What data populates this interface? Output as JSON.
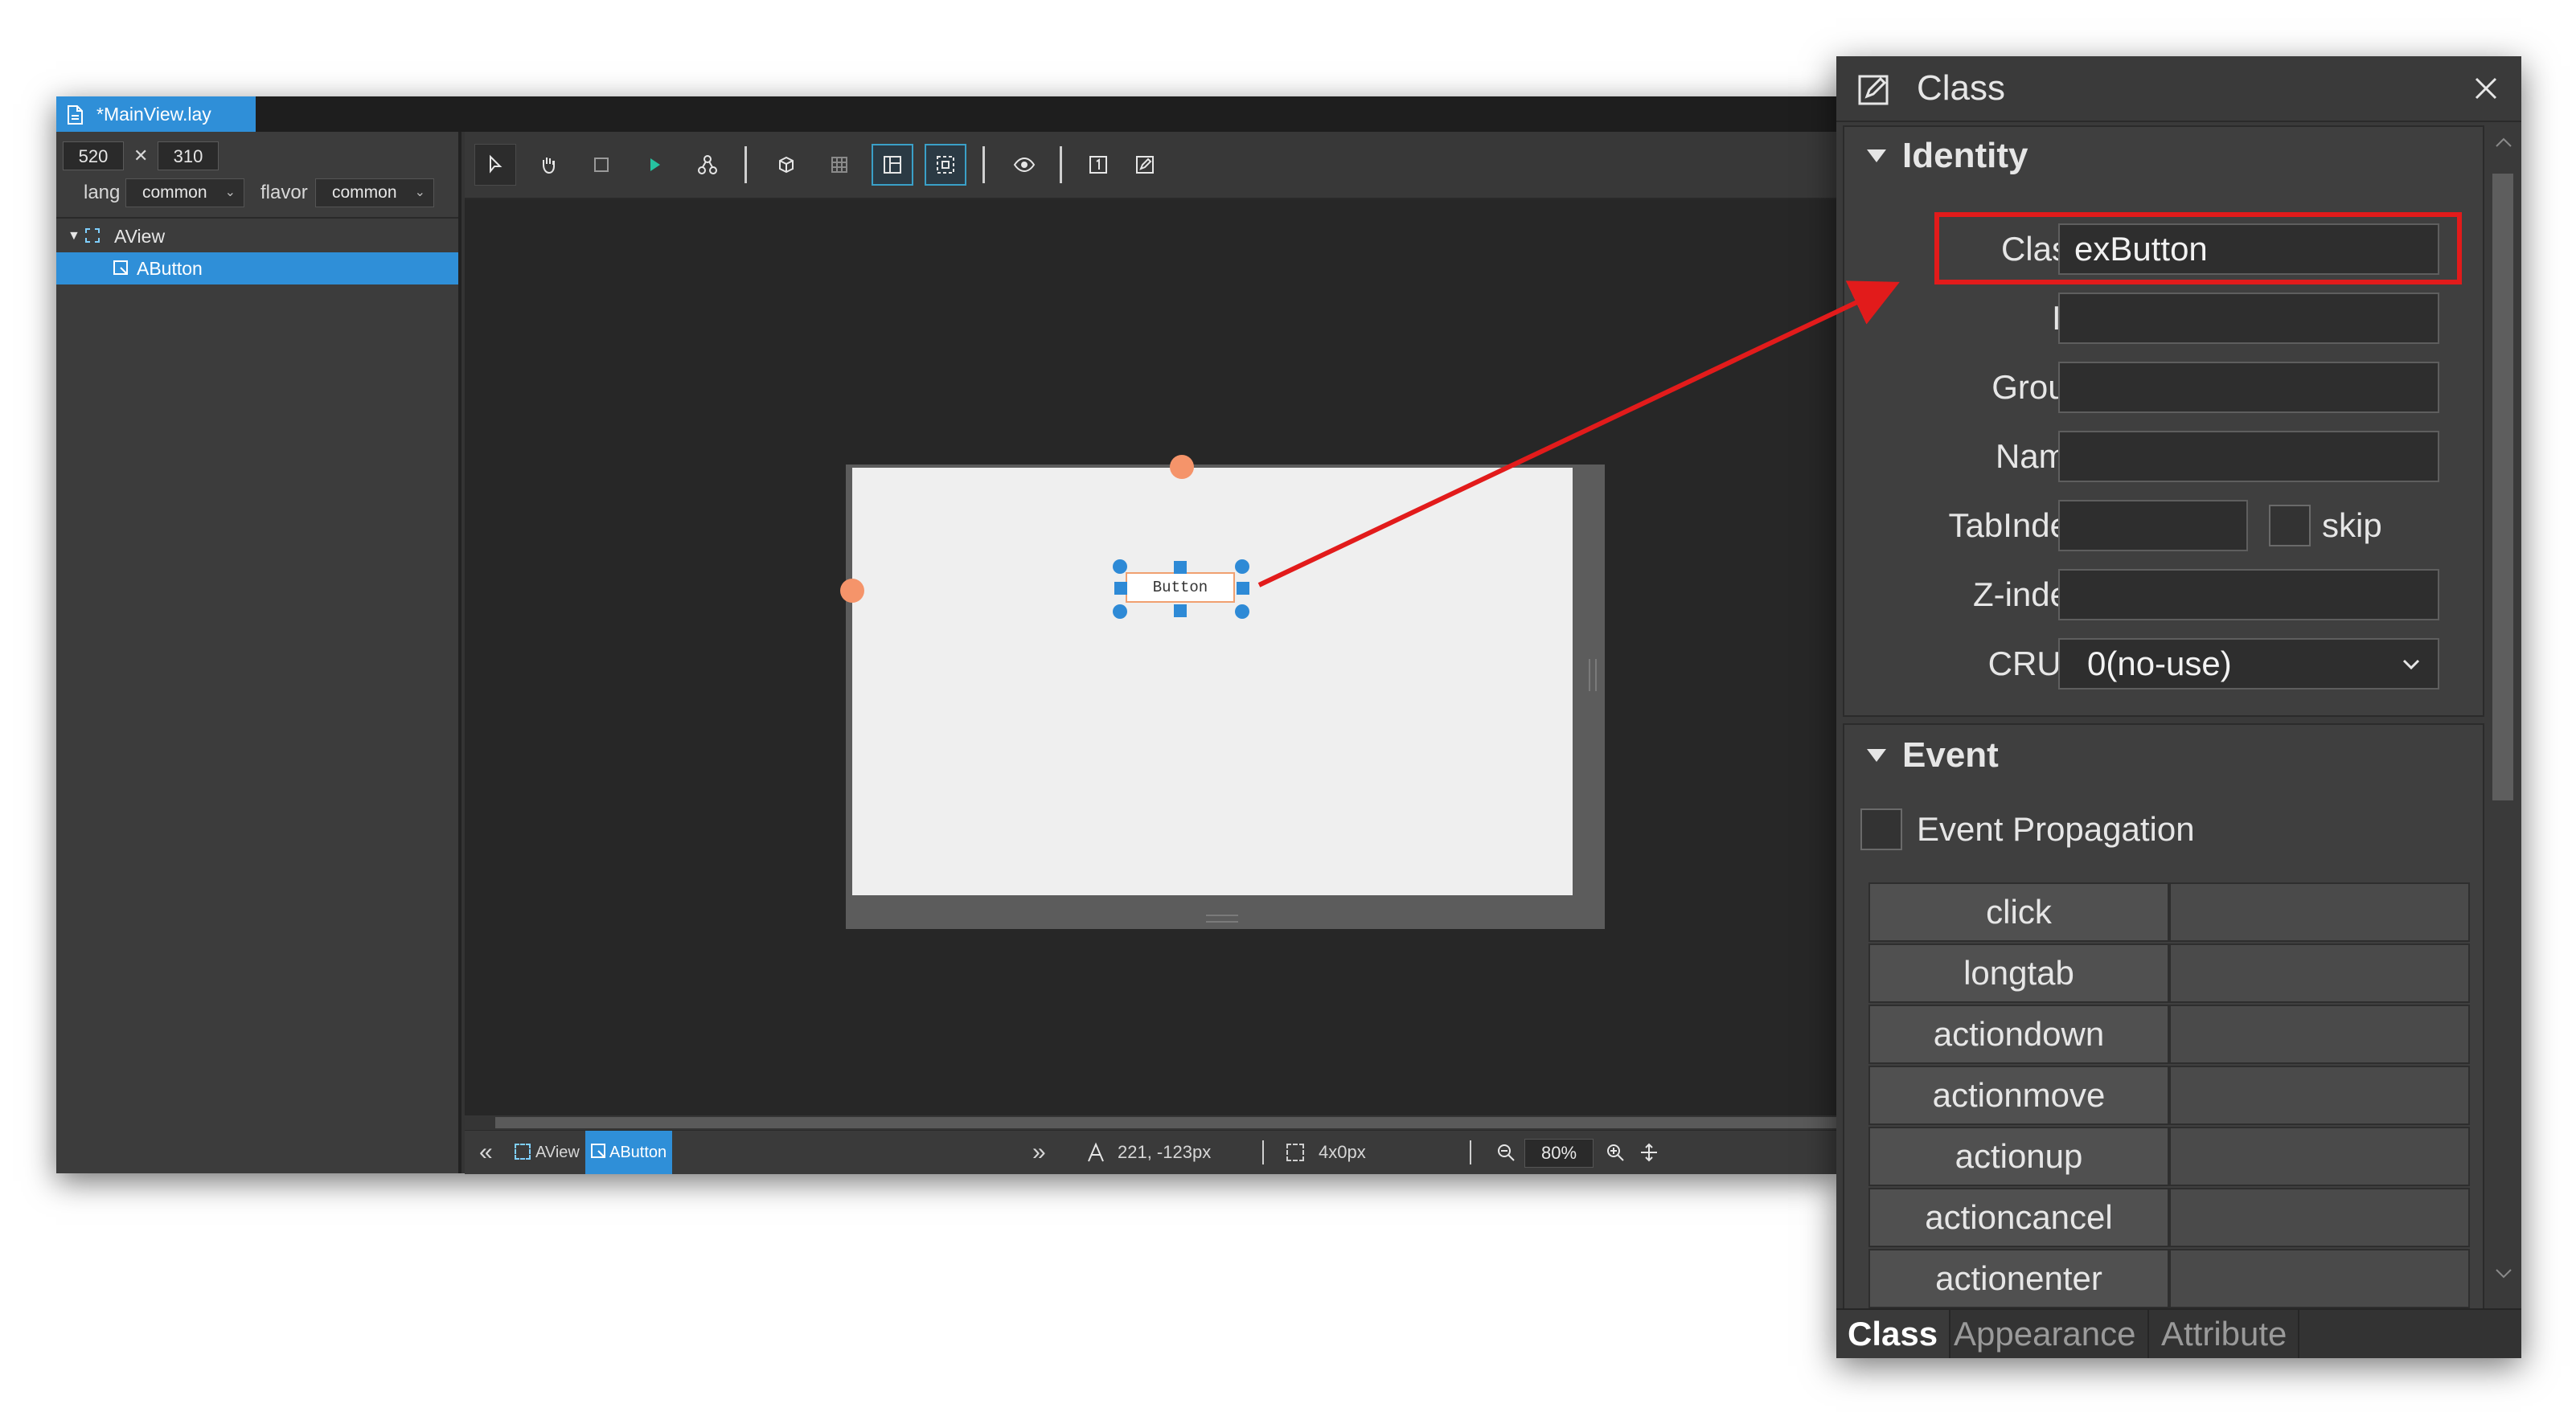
{
  "editor": {
    "file_tab": "*MainView.lay",
    "width_value": "520",
    "times": "✕",
    "height_value": "310",
    "lang_label": "lang",
    "lang_value": "common",
    "flavor_label": "flavor",
    "flavor_value": "common",
    "tree": {
      "root": "AView",
      "child": "AButton"
    },
    "toolbar_icons": [
      "pointer-icon",
      "hand-icon",
      "frame-icon",
      "play-icon",
      "hierarchy-icon",
      "cube-icon",
      "grid-icon",
      "layout-icon",
      "select-area-icon",
      "eye-icon",
      "number-one-icon",
      "edit-icon"
    ],
    "canvas": {
      "button_text": "Button"
    },
    "status": {
      "nav_back": "«",
      "crumb_view": "AView",
      "crumb_button": "AButton",
      "nav_forward": "»",
      "position": "221, -123px",
      "size": "4x0px",
      "zoom": "80%"
    }
  },
  "class_panel": {
    "title": "Class",
    "identity": {
      "title": "Identity",
      "class_label": "Class",
      "class_value": "exButton",
      "id_label": "ID",
      "id_value": "",
      "group_label": "Group",
      "group_value": "",
      "name_label": "Name",
      "name_value": "",
      "tabindex_label": "TabIndex",
      "tabindex_value": "",
      "skip_label": "skip",
      "zindex_label": "Z-index",
      "zindex_value": "",
      "crud_label": "CRUD",
      "crud_value": "0(no-use)"
    },
    "event": {
      "title": "Event",
      "propagation_label": "Event Propagation",
      "rows": [
        "click",
        "longtab",
        "actiondown",
        "actionmove",
        "actionup",
        "actioncancel",
        "actionenter"
      ]
    },
    "tabs": [
      "Class",
      "Appearance",
      "Attribute"
    ]
  },
  "colors": {
    "accent": "#2f8fd8",
    "highlight": "#e21b1b",
    "anchor": "#f5946a"
  }
}
